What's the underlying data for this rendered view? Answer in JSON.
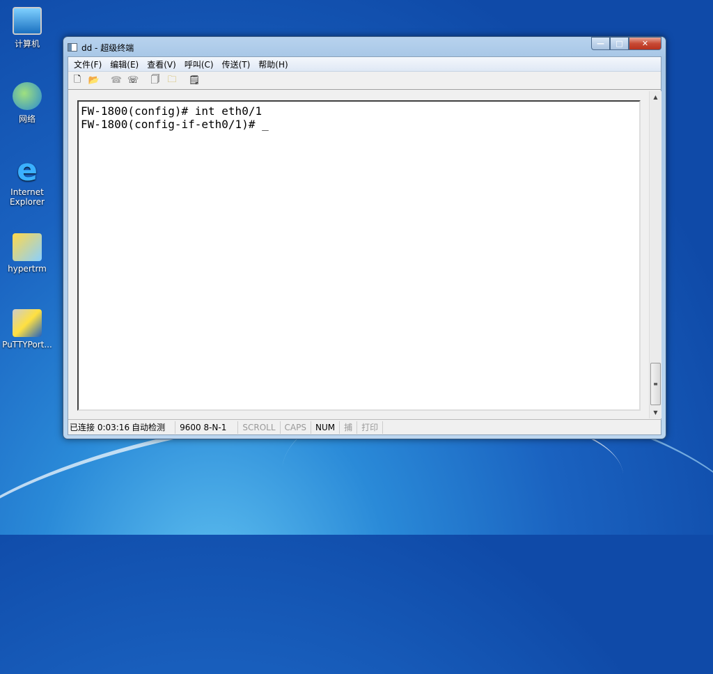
{
  "desktop": {
    "icons": [
      {
        "label": "计算机"
      },
      {
        "label": "网络"
      },
      {
        "label": "Internet Explorer"
      },
      {
        "label": "hypertrm"
      },
      {
        "label": "PuTTYPort..."
      }
    ]
  },
  "window": {
    "title": "dd - 超级终端",
    "menu": [
      "文件(F)",
      "编辑(E)",
      "查看(V)",
      "呼叫(C)",
      "传送(T)",
      "帮助(H)"
    ],
    "toolbar": [
      "new-icon",
      "open-icon",
      "call-icon",
      "disconnect-icon",
      "send-icon",
      "receive-icon",
      "properties-icon"
    ],
    "terminal": {
      "lines": [
        "FW-1800(config)# int eth0/1",
        "FW-1800(config-if-eth0/1)# _"
      ]
    },
    "status": {
      "connected": "已连接 0:03:16",
      "detect": "自动检测",
      "port": "9600 8-N-1",
      "scroll": "SCROLL",
      "caps": "CAPS",
      "num": "NUM",
      "capture": "捕",
      "print": "打印"
    }
  }
}
